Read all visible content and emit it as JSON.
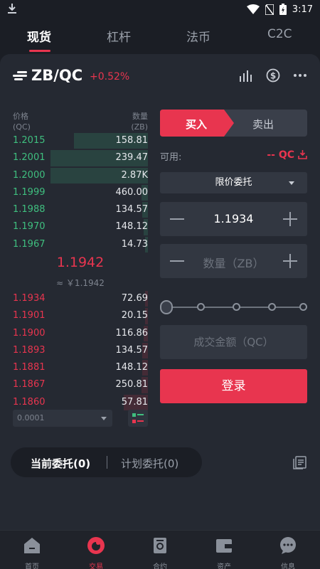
{
  "status_bar": {
    "time": "3:17"
  },
  "top_tabs": [
    "现货",
    "杠杆",
    "法币",
    "C2C"
  ],
  "pair": {
    "name": "ZB/QC",
    "change": "+0.52%"
  },
  "orderbook": {
    "price_header": "价格",
    "price_unit": "(QC)",
    "qty_header": "数量",
    "qty_unit": "(ZB)",
    "bids": [
      {
        "price": "1.2015",
        "qty": "158.81",
        "depth": 0.55
      },
      {
        "price": "1.2001",
        "qty": "239.47",
        "depth": 0.72
      },
      {
        "price": "1.2000",
        "qty": "2.87K",
        "depth": 0.72
      },
      {
        "price": "1.1999",
        "qty": "460.00",
        "depth": 0.05
      },
      {
        "price": "1.1988",
        "qty": "134.57",
        "depth": 0.04
      },
      {
        "price": "1.1970",
        "qty": "148.12",
        "depth": 0.03
      },
      {
        "price": "1.1967",
        "qty": "14.73",
        "depth": 0.02
      }
    ],
    "last_price": "1.1942",
    "last_price_cny": "≈ ￥1.1942",
    "asks": [
      {
        "price": "1.1934",
        "qty": "72.69",
        "depth": 0.02
      },
      {
        "price": "1.1901",
        "qty": "20.15",
        "depth": 0.02
      },
      {
        "price": "1.1900",
        "qty": "116.86",
        "depth": 0.03
      },
      {
        "price": "1.1893",
        "qty": "134.57",
        "depth": 0.04
      },
      {
        "price": "1.1881",
        "qty": "148.12",
        "depth": 0.04
      },
      {
        "price": "1.1867",
        "qty": "250.81",
        "depth": 0.05
      },
      {
        "price": "1.1860",
        "qty": "57.81",
        "depth": 0.18
      }
    ],
    "depth_precision": "0.0001"
  },
  "trade_form": {
    "buy_tab": "买入",
    "sell_tab": "卖出",
    "available_label": "可用:",
    "available_value": "-- QC",
    "order_type": "限价委托",
    "price_value": "1.1934",
    "amount_placeholder": "数量（ZB）",
    "total_placeholder": "成交金额（QC）",
    "login_button": "登录"
  },
  "orders_tabs": {
    "current": "当前委托(0)",
    "planned": "计划委托(0)"
  },
  "bottom_nav": [
    "首页",
    "交易",
    "合约",
    "资产",
    "信息"
  ],
  "colors": {
    "accent": "#e8354f",
    "green": "#3fbf7f",
    "background": "#1b1e25",
    "panel": "#252932"
  }
}
